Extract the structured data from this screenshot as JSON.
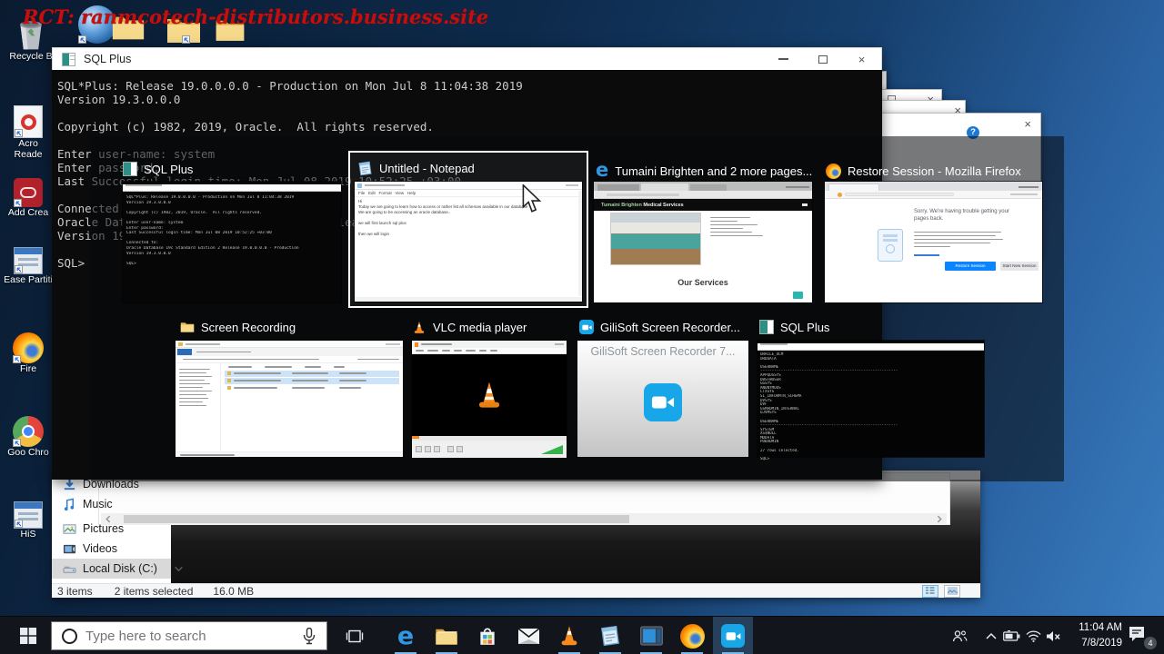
{
  "glyphs": {
    "close": "×",
    "help": "?",
    "scroll_up": "^"
  },
  "colors": {
    "watermark": "#c40f0f",
    "edge_blue": "#3097e0",
    "vlc_orange": "#f78a1d",
    "gilisoft_blue": "#17a7e8",
    "taskbar_underline": "#7ab8e8"
  },
  "desktop": {
    "watermark": "RCT: ranmcotech-distributors.business.site",
    "icons": [
      {
        "label": "Recycle B",
        "icon": "recycle-bin-icon"
      },
      {
        "label": "Acro Reade",
        "icon": "acrobat-reader-icon"
      },
      {
        "label": "Add Crea",
        "icon": "adobe-creative-icon"
      },
      {
        "label": "Ease Partiti",
        "icon": "partition-tool-icon"
      },
      {
        "label": "Fire",
        "icon": "firefox-icon"
      },
      {
        "label": "Goo Chro",
        "icon": "chrome-icon"
      },
      {
        "label": "HiS",
        "icon": "hisuite-icon"
      }
    ]
  },
  "sql_window": {
    "title": "SQL Plus",
    "console_lines": [
      "SQL*Plus: Release 19.0.0.0.0 - Production on Mon Jul 8 11:04:38 2019",
      "Version 19.3.0.0.0",
      "",
      "Copyright (c) 1982, 2019, Oracle.  All rights reserved.",
      "",
      "Enter user-name: system",
      "Enter password:",
      "Last Successful login time: Mon Jul 08 2019 10:52:25 +03:00",
      "",
      "Connected to:",
      "Oracle Database 19c Standard Edition 2 Release 19.0.0.0.0 - Production",
      "Version 19.3.0.0.0",
      "",
      "SQL>"
    ]
  },
  "task_switcher": {
    "items": [
      {
        "label": "SQL Plus",
        "icon": "sqlplus-icon",
        "selected": false
      },
      {
        "label": "Untitled - Notepad",
        "icon": "notepad-icon",
        "selected": true
      },
      {
        "label": "Tumaini Brighten and 2 more pages...",
        "icon": "edge-icon",
        "selected": false
      },
      {
        "label": "Restore Session - Mozilla Firefox",
        "icon": "firefox-icon",
        "selected": false
      },
      {
        "label": "Screen Recording",
        "icon": "folder-icon",
        "selected": false
      },
      {
        "label": "VLC media player",
        "icon": "vlc-icon",
        "selected": false
      },
      {
        "label": "GiliSoft Screen Recorder...",
        "icon": "gilisoft-icon",
        "selected": false
      },
      {
        "label": "SQL Plus",
        "icon": "sqlplus-icon",
        "selected": false
      }
    ]
  },
  "thumbnails": {
    "notepad": {
      "menu": "File   Edit   Format   View   Help",
      "lines": [
        "Hi",
        "Today we are going to learn how to access or rather list all schemas available in our database",
        "We are going to be accessing an oracle database..",
        "",
        "we will first launch sql plus",
        "",
        "then we will login"
      ]
    },
    "edge_page": {
      "title_accent": "Tumaini Brighten",
      "title_rest": " Medical Services",
      "section_heading": "Our Services"
    },
    "firefox_page": {
      "heading": "Sorry. We're having trouble getting your pages back.",
      "primary_button": "Restore Session",
      "secondary_button": "Start New Session"
    },
    "gilisoft": {
      "window_title": "GiliSoft Screen Recorder 7..."
    },
    "sqlplus_output": [
      "ORACLE_OCM",
      "ORDDATA",
      "",
      "USERNAME",
      "------------------------------------------------------------",
      "APPQOSSYS",
      "DBSFWUSER",
      "GGSYS",
      "ANONYMOUS",
      "CTXSYS",
      "SI_INFORMTN_SCHEMA",
      "DVSYS",
      "DVF",
      "GSMADMIN_INTERNAL",
      "OJVMSYS",
      "",
      "USERNAME",
      "------------------------------------------------------------",
      "SYSTEM",
      "XS$NULL",
      "MDDATA",
      "PDBADMIN",
      "",
      "27 rows selected.",
      "",
      "SQL>"
    ]
  },
  "explorer": {
    "nav_items": [
      {
        "label": "Downloads",
        "icon": "downloads-icon",
        "selected": false
      },
      {
        "label": "Music",
        "icon": "music-icon",
        "selected": false
      },
      {
        "label": "Pictures",
        "icon": "pictures-icon",
        "selected": false
      },
      {
        "label": "Videos",
        "icon": "videos-icon",
        "selected": false
      },
      {
        "label": "Local Disk (C:)",
        "icon": "drive-icon",
        "selected": true
      }
    ],
    "status_bar": {
      "items_count": "3 items",
      "selected_count": "2 items selected",
      "size": "16.0 MB"
    }
  },
  "taskbar": {
    "search_placeholder": "Type here to search",
    "apps": [
      {
        "icon": "edge-icon",
        "active": true
      },
      {
        "icon": "file-explorer-icon",
        "active": true
      },
      {
        "icon": "store-icon",
        "active": false
      },
      {
        "icon": "mail-icon",
        "active": false
      },
      {
        "icon": "vlc-icon",
        "active": true
      },
      {
        "icon": "notepad-icon",
        "active": true
      },
      {
        "icon": "media-window-icon",
        "active": true
      },
      {
        "icon": "firefox-icon",
        "active": true
      },
      {
        "icon": "gilisoft-icon",
        "active": true,
        "focused": true
      }
    ],
    "tray": {
      "time": "11:04 AM",
      "date": "7/8/2019",
      "notification_count": "4"
    }
  }
}
